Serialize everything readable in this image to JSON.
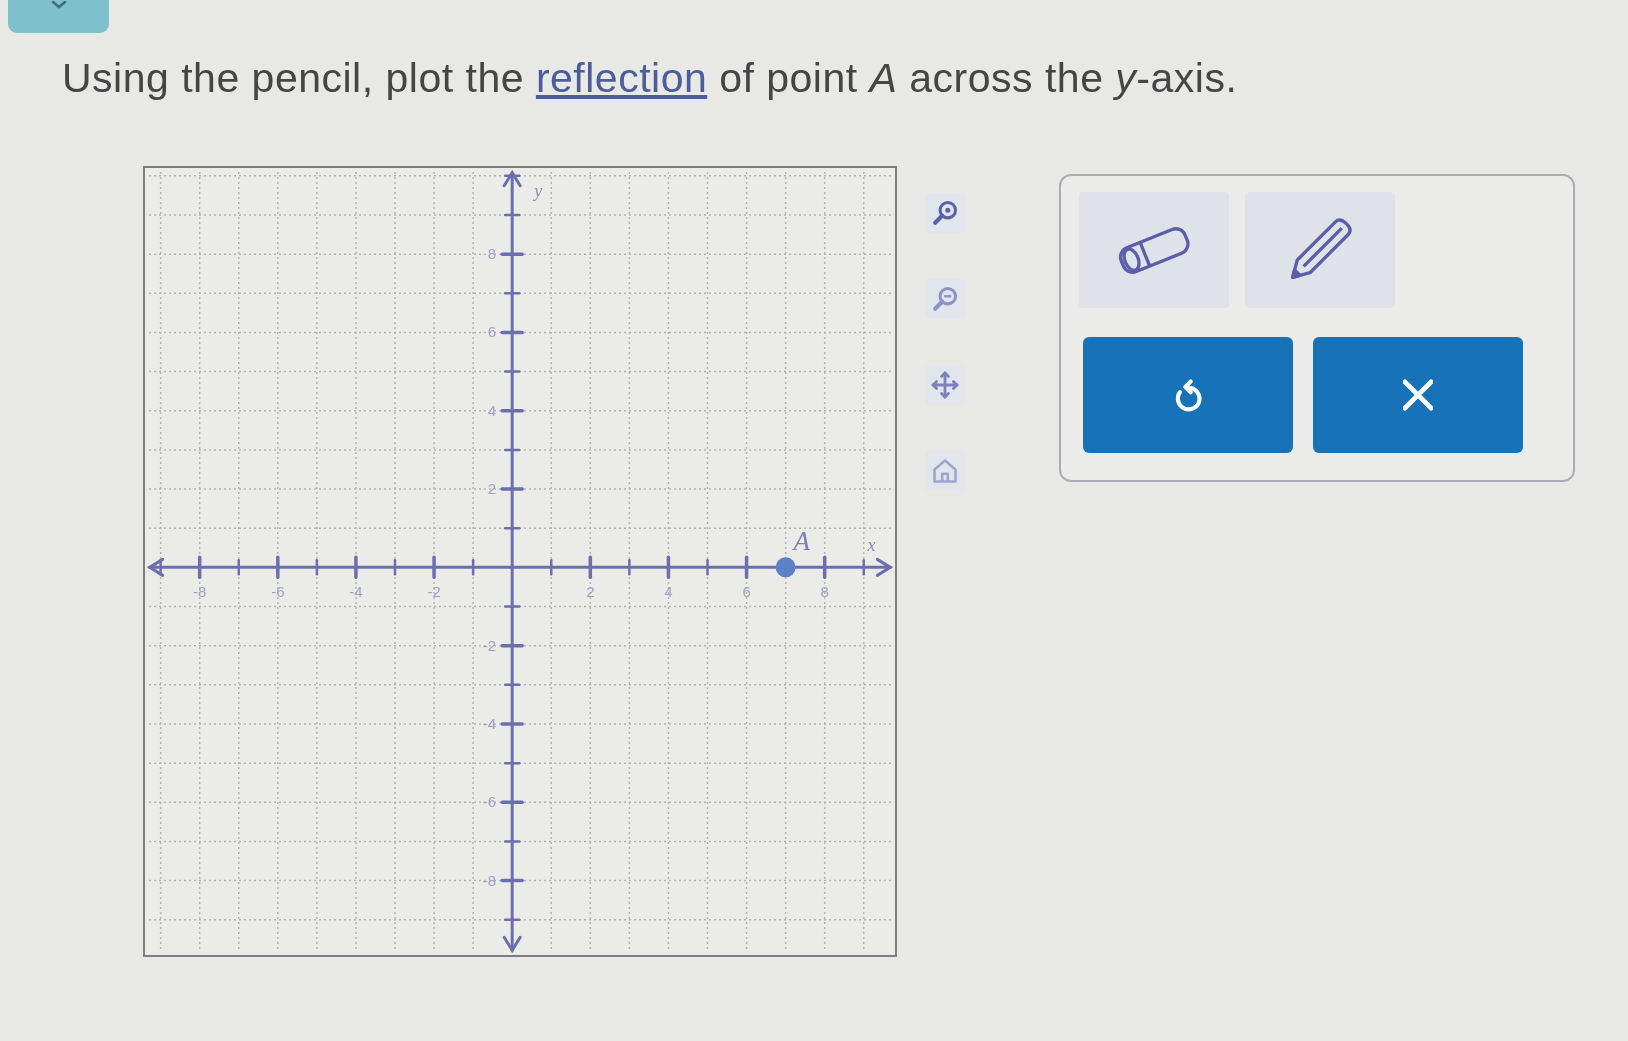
{
  "instruction": {
    "before": "Using the pencil, plot the ",
    "link": "reflection",
    "after": " of point *A* across the *y*-axis."
  },
  "graph": {
    "chart_data": {
      "type": "scatter",
      "xlabel": "x",
      "ylabel": "y",
      "x": [
        7
      ],
      "series": [
        {
          "name": "A",
          "color": "#5b82c6",
          "values": [
            0
          ]
        }
      ],
      "xlim": [
        -9.4,
        9.8
      ],
      "ylim": [
        -9.9,
        10.2
      ],
      "xticks": [
        -8,
        -6,
        -4,
        -2,
        2,
        4,
        6,
        8
      ],
      "yticks": [
        -8,
        -6,
        -4,
        -2,
        2,
        4,
        6,
        8
      ],
      "grid": true
    }
  }
}
